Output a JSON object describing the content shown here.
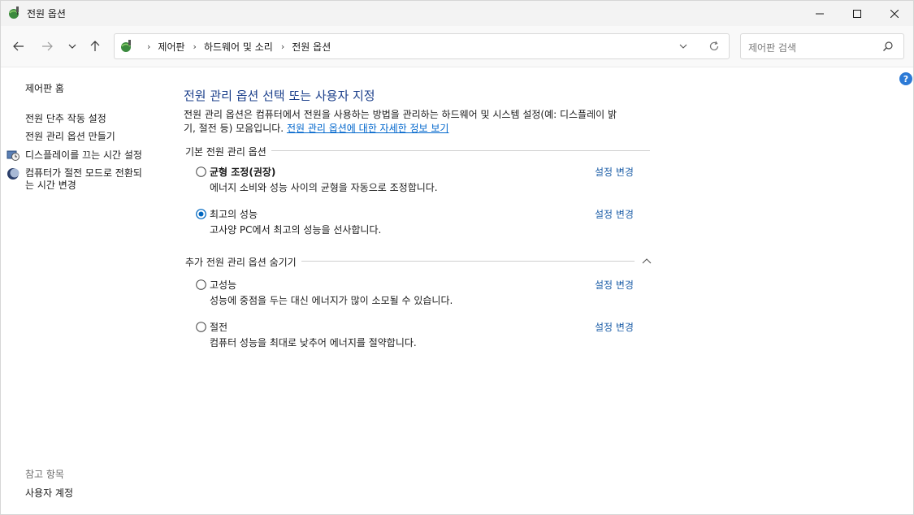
{
  "window": {
    "title": "전원 옵션",
    "controls": {
      "minimize": "minimize-icon",
      "maximize": "maximize-icon",
      "close": "close-icon"
    }
  },
  "nav": {
    "breadcrumbs": [
      "제어판",
      "하드웨어 및 소리",
      "전원 옵션"
    ],
    "search_placeholder": "제어판 검색"
  },
  "sidebar": {
    "home": "제어판 홈",
    "links": [
      "전원 단추 작동 설정",
      "전원 관리 옵션 만들기",
      "디스플레이를 끄는 시간 설정",
      "컴퓨터가 절전 모드로 전환되는 시간 변경"
    ],
    "link4_line1": "컴퓨터가 절전 모드로 전환되",
    "link4_line2": "는 시간 변경",
    "see_also_title": "참고 항목",
    "see_also_links": [
      "사용자 계정"
    ]
  },
  "main": {
    "heading": "전원 관리 옵션 선택 또는 사용자 지정",
    "description_line1": "전원 관리 옵션은 컴퓨터에서 전원을 사용하는 방법을 관리하는 하드웨어 및 시스템 설정(예: 디스플레이 밝",
    "description_line2_prefix": "기, 절전 등) 모음입니다. ",
    "description_link": "전원 관리 옵션에 대한 자세한 정보 보기",
    "preferred_group": "기본 전원 관리 옵션",
    "additional_group": "추가 전원 관리 옵션 숨기기",
    "change_label": "설정 변경",
    "plans": [
      {
        "name": "균형 조정(권장)",
        "description": "에너지 소비와 성능 사이의 균형을 자동으로 조정합니다.",
        "selected": false
      },
      {
        "name": "최고의 성능",
        "description": "고사양 PC에서 최고의 성능을 선사합니다.",
        "selected": true
      },
      {
        "name": "고성능",
        "description": "성능에 중점을 두는 대신 에너지가 많이 소모될 수 있습니다.",
        "selected": false
      },
      {
        "name": "절전",
        "description": "컴퓨터 성능을 최대로 낮추어 에너지를 절약합니다.",
        "selected": false
      }
    ]
  },
  "help_label": "?",
  "colors": {
    "heading": "#1b3f8b",
    "link": "#1e5fa8",
    "accent": "#0067c0"
  }
}
